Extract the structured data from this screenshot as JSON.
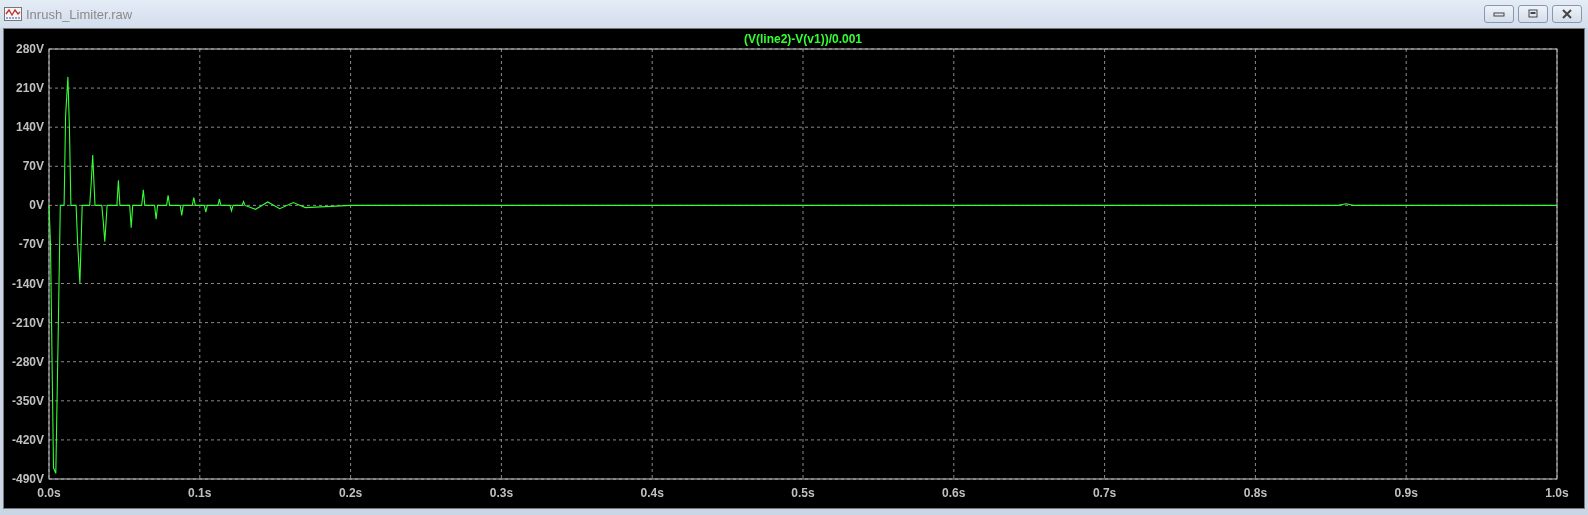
{
  "window": {
    "title": "Inrush_Limiter.raw"
  },
  "plot": {
    "chart_data": {
      "type": "line",
      "grid": true,
      "xlim": [
        0,
        1
      ],
      "ylim": [
        -490,
        280
      ],
      "xticks": [
        {
          "value": 0,
          "label": "0.0s"
        },
        {
          "value": 0.1,
          "label": "0.1s"
        },
        {
          "value": 0.2,
          "label": "0.2s"
        },
        {
          "value": 0.3,
          "label": "0.3s"
        },
        {
          "value": 0.4,
          "label": "0.4s"
        },
        {
          "value": 0.5,
          "label": "0.5s"
        },
        {
          "value": 0.6,
          "label": "0.6s"
        },
        {
          "value": 0.7,
          "label": "0.7s"
        },
        {
          "value": 0.8,
          "label": "0.8s"
        },
        {
          "value": 0.9,
          "label": "0.9s"
        },
        {
          "value": 1,
          "label": "1.0s"
        }
      ],
      "yticks": [
        {
          "value": 280,
          "label": "280V"
        },
        {
          "value": 210,
          "label": "210V"
        },
        {
          "value": 140,
          "label": "140V"
        },
        {
          "value": 70,
          "label": "70V"
        },
        {
          "value": 0,
          "label": "0V"
        },
        {
          "value": -70,
          "label": "-70V"
        },
        {
          "value": -140,
          "label": "-140V"
        },
        {
          "value": -210,
          "label": "-210V"
        },
        {
          "value": -280,
          "label": "-280V"
        },
        {
          "value": -350,
          "label": "-350V"
        },
        {
          "value": -420,
          "label": "-420V"
        },
        {
          "value": -490,
          "label": "-490V"
        }
      ],
      "x": [
        0,
        0.001,
        0.003,
        0.0045,
        0.006,
        0.0075,
        0.01,
        0.011,
        0.0125,
        0.0135,
        0.0145,
        0.018,
        0.019,
        0.0205,
        0.022,
        0.027,
        0.028,
        0.029,
        0.0305,
        0.035,
        0.036,
        0.037,
        0.0385,
        0.045,
        0.046,
        0.047,
        0.0535,
        0.0545,
        0.0555,
        0.0615,
        0.0625,
        0.0635,
        0.07,
        0.071,
        0.072,
        0.078,
        0.079,
        0.08,
        0.087,
        0.088,
        0.089,
        0.095,
        0.096,
        0.097,
        0.103,
        0.104,
        0.105,
        0.112,
        0.113,
        0.114,
        0.12,
        0.121,
        0.122,
        0.128,
        0.129,
        0.13,
        0.137,
        0.145,
        0.153,
        0.162,
        0.17,
        0.2,
        0.3,
        0.5,
        0.7,
        0.855,
        0.86,
        0.865,
        1
      ],
      "series": [
        {
          "name": "(V(line2)-V(v1))/0.001",
          "color": "#33ff33",
          "values": [
            0,
            -70,
            -470,
            -480,
            -250,
            0,
            0,
            160,
            230,
            140,
            0,
            0,
            -70,
            -140,
            0,
            0,
            40,
            90,
            0,
            0,
            -30,
            -65,
            0,
            0,
            45,
            0,
            0,
            -40,
            0,
            0,
            28,
            0,
            0,
            -25,
            0,
            0,
            18,
            0,
            0,
            -18,
            0,
            0,
            14,
            0,
            0,
            -12,
            0,
            0,
            11,
            0,
            0,
            -10,
            0,
            0,
            7,
            0,
            -7,
            6,
            -6,
            5,
            -4,
            0,
            0,
            0,
            0,
            0,
            3,
            0,
            0
          ]
        }
      ]
    }
  }
}
